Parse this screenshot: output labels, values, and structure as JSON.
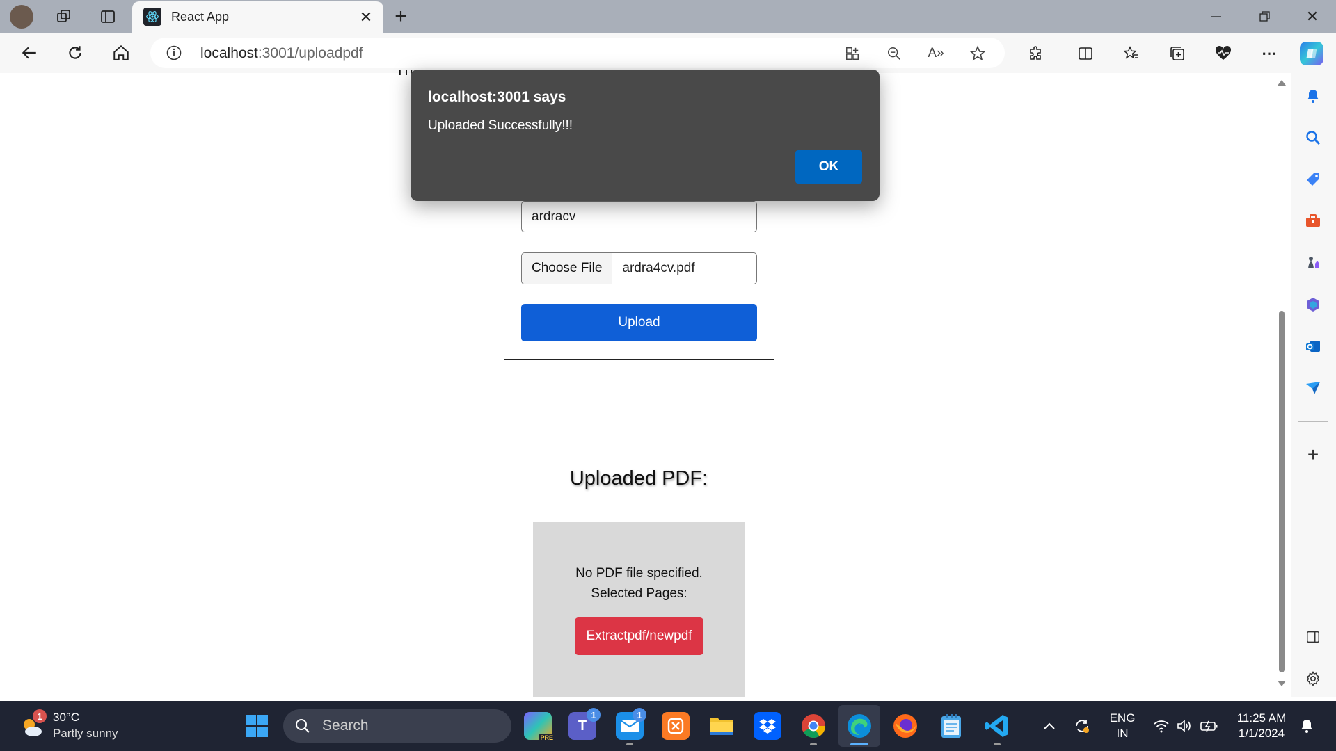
{
  "browser": {
    "tab_title": "React App",
    "url_host": "localhost",
    "url_path": ":3001/uploadpdf"
  },
  "page": {
    "name_value": "ardracv",
    "file_button_label": "Choose File",
    "file_name": "ardra4cv.pdf",
    "upload_label": "Upload",
    "uploaded_heading": "Uploaded PDF:",
    "no_pdf_text": "No PDF file specified.",
    "selected_pages_text": "Selected Pages:",
    "extract_label": "Extractpdf/newpdf"
  },
  "alert": {
    "title": "localhost:3001 says",
    "message": "Uploaded Successfully!!!",
    "ok_label": "OK"
  },
  "taskbar": {
    "weather_temp": "30°C",
    "weather_desc": "Partly sunny",
    "weather_badge": "1",
    "search_label": "Search",
    "teams_badge": "1",
    "mail_badge": "1",
    "lang_top": "ENG",
    "lang_bottom": "IN",
    "time": "11:25 AM",
    "date": "1/1/2024"
  },
  "colors": {
    "upload_button": "#0f5fd7",
    "extract_button": "#dc3545",
    "alert_bg": "#494949",
    "alert_ok": "#0067c0",
    "taskbar_bg": "#1f2433"
  }
}
